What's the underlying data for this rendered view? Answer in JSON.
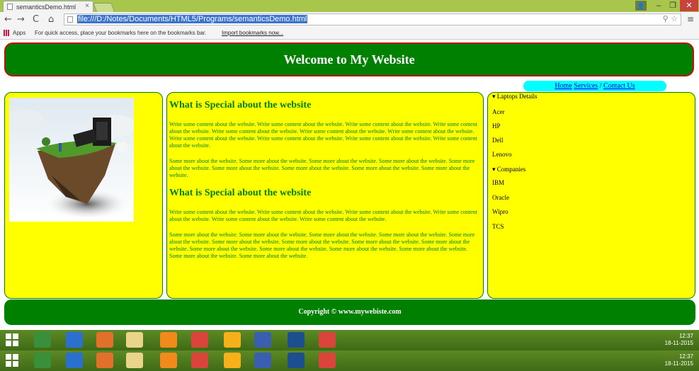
{
  "browser": {
    "tab_title": "semanticsDemo.html",
    "url": "file:///D:/Notes/Documents/HTML5/Programs/semanticsDemo.html",
    "bookmarks_apps": "Apps",
    "bookmarks_message": "For quick access, place your bookmarks here on the bookmarks bar.",
    "bookmarks_link": "Import bookmarks now..."
  },
  "page": {
    "header_title": "Welcome to My Website",
    "nav": {
      "home": "Home",
      "services": "Services",
      "contact": "Contact Us",
      "sep1": " ",
      "sep2": " / "
    },
    "main": {
      "heading1": "What is Special about the website",
      "para1": "Write some content about the website. Write some content about the website. Write some content about the website. Write some content about the website. Write some content about the website. Write some content about the website. Write some content about the website. Write some content about the website. Write some content about the website. Write some content about the website. Write some content about the website.",
      "para2": "Some more about the website. Some more about the website. Some more about the website. Some more about the website. Some more about the website. Some more about the website. Some more about the website. Some more about the website. Some more about the website.",
      "heading2": "What is Special about the website",
      "para3": "Write some content about the website. Write some content about the website. Write some content about the website. Write some content about the website. Write some content about the website. Write some content about the website.",
      "para4": "Some more about the website. Some more about the website. Some more about the website. Some more about the website. Some more about the website. Some more about the website. Some more about the website. Some more about the website. Some more about the website. Some more about the website. Some more about the website. Some more about the website. Some more about the website. Some more about the website. Some more about the website."
    },
    "aside": {
      "laptops_summary": "Laptops Details",
      "laptops": [
        "Acer",
        "HP",
        "Dell",
        "Lenovo"
      ],
      "companies_summary": "Companies",
      "companies": [
        "IBM",
        "Oracle",
        "Wipro",
        "TCS"
      ]
    },
    "footer": "Copyright © www.mywebiste.com"
  },
  "taskbar": {
    "time": "12:37",
    "date": "18-11-2015"
  },
  "colors": {
    "header_bg": "#008000",
    "header_border": "#c01010",
    "content_bg": "#ffff00",
    "nav_bg": "#00ffff",
    "text_green": "#008000"
  }
}
